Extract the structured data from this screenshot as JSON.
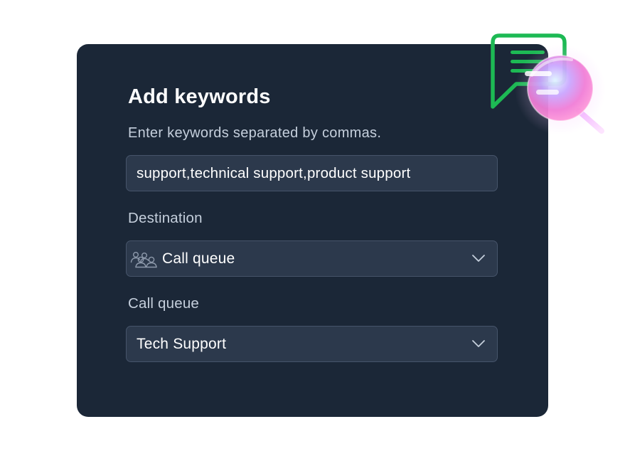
{
  "panel": {
    "title": "Add keywords",
    "instructions": "Enter keywords separated by commas.",
    "keywords_value": "support,technical support,product support",
    "destination": {
      "label": "Destination",
      "selected": "Call queue",
      "icon": "people-group-icon"
    },
    "call_queue": {
      "label": "Call queue",
      "selected": "Tech Support"
    }
  },
  "colors": {
    "card_bg": "#1b2737",
    "field_bg": "#2c394c",
    "field_border": "#46546a",
    "text_primary": "#ffffff",
    "text_secondary": "#c5cfdc",
    "brand_green": "#1db954"
  },
  "icons": {
    "decoration": "chat-bubble-magnifier-icon",
    "dropdown": "chevron-down-icon"
  }
}
